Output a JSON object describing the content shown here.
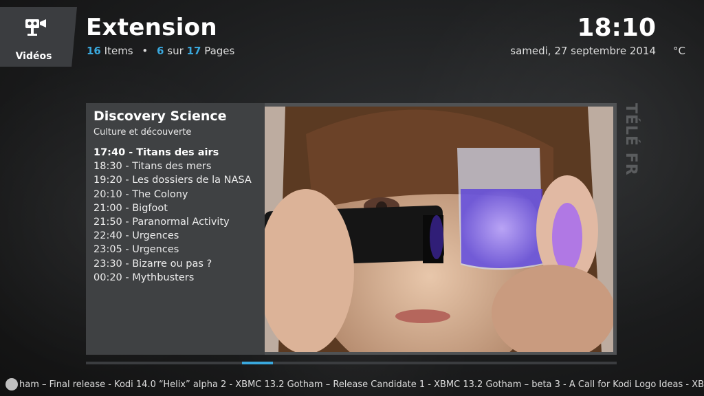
{
  "section": {
    "label": "Vidéos",
    "icon": "video-camera-icon"
  },
  "header": {
    "title": "Extension",
    "items_count": "16",
    "items_label": "Items",
    "bullet": "•",
    "page_current": "6",
    "page_of": "sur",
    "page_total": "17",
    "pages_label": "Pages"
  },
  "clock": {
    "time": "18:10",
    "date": "samedi, 27 septembre 2014",
    "temperature": "°C"
  },
  "channel": {
    "name": "Discovery Science",
    "genre": "Culture et découverte",
    "side_label": "TÉLÉ FR",
    "thumbnail_icon": "girl-with-flashlight-and-beaker-image",
    "schedule": [
      {
        "text": "17:40 - Titans des airs",
        "current": true
      },
      {
        "text": "18:30 - Titans des mers",
        "current": false
      },
      {
        "text": "19:20 - Les dossiers de la NASA",
        "current": false
      },
      {
        "text": "20:10 - The Colony",
        "current": false
      },
      {
        "text": "21:00 - Bigfoot",
        "current": false
      },
      {
        "text": "21:50 - Paranormal Activity",
        "current": false
      },
      {
        "text": "22:40 - Urgences",
        "current": false
      },
      {
        "text": "23:05 - Urgences",
        "current": false
      },
      {
        "text": "23:30 - Bizarre ou pas ?",
        "current": false
      },
      {
        "text": "00:20 - Mythbusters",
        "current": false
      }
    ]
  },
  "scroll": {
    "position_fraction": 0.294,
    "thumb_fraction": 0.058
  },
  "ticker": {
    "icon": "rss-feed-icon",
    "text": "ham – Final release - Kodi 14.0 “Helix” alpha 2 - XBMC 13.2 Gotham – Release Candidate 1 - XBMC 13.2 Gotham – beta 3 - A Call for Kodi Logo Ideas - XBMC Is Getting a"
  },
  "colors": {
    "accent": "#3aa8dd",
    "panel": "#505254",
    "info_panel": "#3f4143"
  }
}
